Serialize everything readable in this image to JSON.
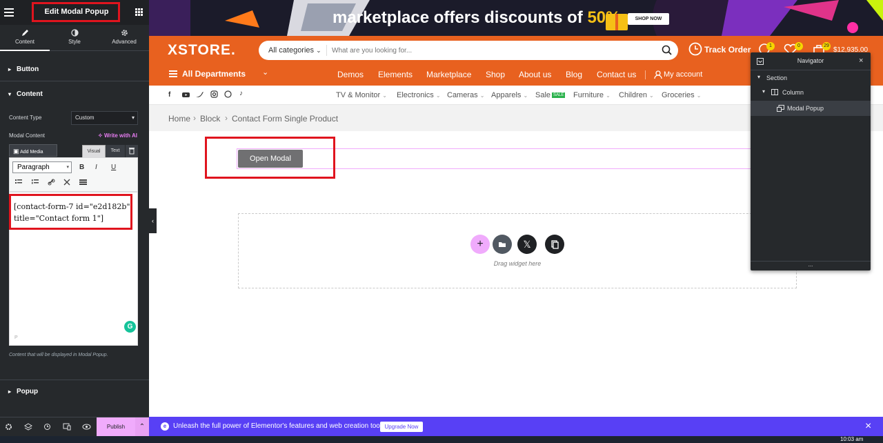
{
  "editor": {
    "title": "Edit Modal Popup",
    "tabs": [
      {
        "label": "Content",
        "icon": "pencil-icon",
        "active": true
      },
      {
        "label": "Style",
        "icon": "half-circle-icon"
      },
      {
        "label": "Advanced",
        "icon": "gear-icon"
      }
    ],
    "sections": {
      "button": "Button",
      "content": "Content",
      "popup": "Popup"
    },
    "content_type_label": "Content Type",
    "content_type_value": "Custom",
    "modal_content_label": "Modal Content",
    "write_ai": "Write with AI",
    "add_media": "Add Media",
    "visual_tab": "Visual",
    "text_tab": "Text",
    "paragraph_select": "Paragraph",
    "fmt": {
      "bold": "B",
      "italic": "I",
      "underline": "U"
    },
    "shortcode": "[contact-form-7 id=\"e2d182b\" title=\"Contact form 1\"]",
    "path_marker": "P",
    "grammarly": "G",
    "help_text": "Content that will be displayed in Modal Popup.",
    "publish": "Publish"
  },
  "site": {
    "banner_text": "marketplace offers discounts of",
    "banner_percent": "50%",
    "shop_now": "SHOP NOW",
    "logo": "XSTORE.",
    "search_category": "All categories",
    "search_placeholder": "What are you looking for...",
    "track_order": "Track Order",
    "wishlist_count": "1",
    "favorites_count": "0",
    "cart_count": "29",
    "cart_total": "$12,935.00",
    "all_departments": "All Departments",
    "menu": [
      "Demos",
      "Elements",
      "Marketplace",
      "Shop",
      "About us",
      "Blog",
      "Contact us"
    ],
    "my_account": "My account",
    "categories": [
      "TV & Monitor",
      "Electronics",
      "Cameras",
      "Apparels",
      "Sale",
      "Furniture",
      "Children",
      "Groceries"
    ],
    "sale_badge": "SALE",
    "breadcrumb": [
      "Home",
      "Block",
      "Contact Form Single Product"
    ],
    "open_modal": "Open Modal",
    "drag_widget": "Drag widget here"
  },
  "navigator": {
    "title": "Navigator",
    "tree": [
      "Section",
      "Column",
      "Modal Popup"
    ],
    "footer": "..."
  },
  "promo": {
    "text": "Unleash the full power of Elementor's features and web creation tools.",
    "button": "Upgrade Now"
  },
  "taskbar": {
    "time": "10:03 am"
  },
  "colors": {
    "accent_orange": "#e8611f",
    "panel": "#26292c",
    "promo": "#5840f5",
    "pink": "#f59ce6",
    "highlight": "#e0141e"
  }
}
